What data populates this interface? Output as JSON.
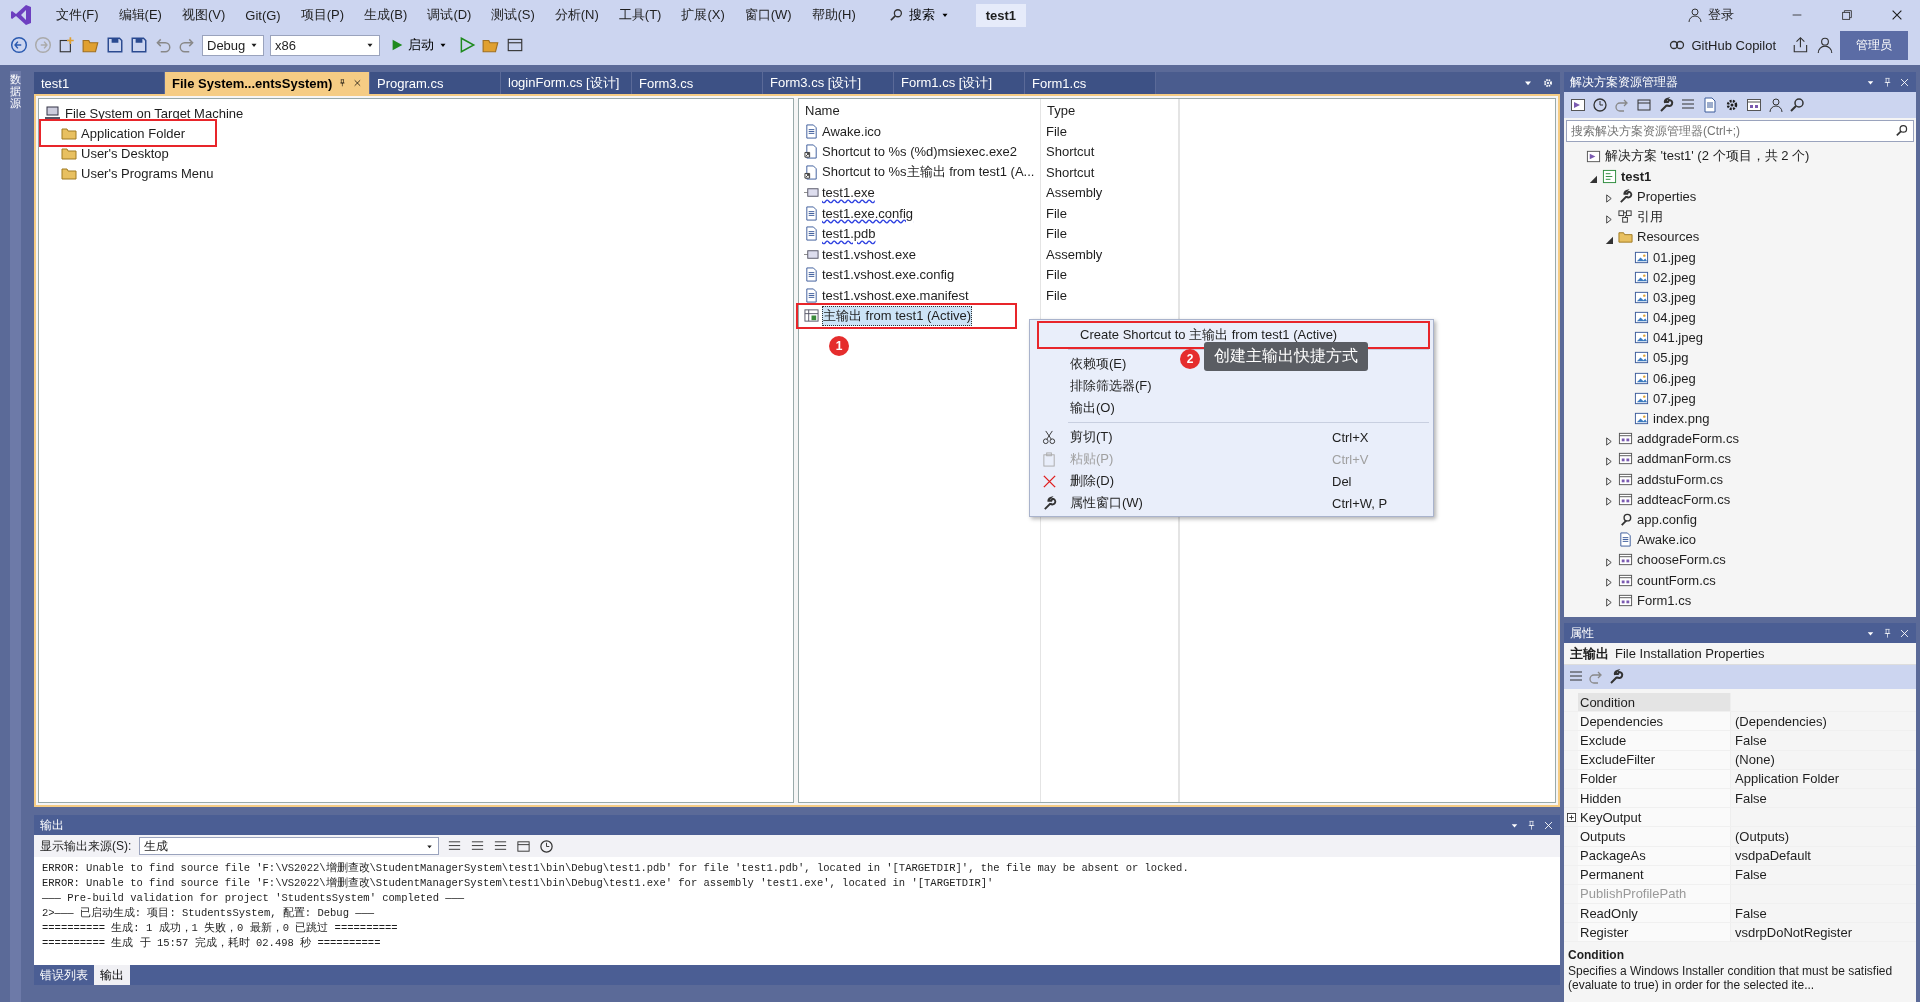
{
  "title_bar": {
    "menu": [
      "文件(F)",
      "编辑(E)",
      "视图(V)",
      "Git(G)",
      "项目(P)",
      "生成(B)",
      "调试(D)",
      "测试(S)",
      "分析(N)",
      "工具(T)",
      "扩展(X)",
      "窗口(W)",
      "帮助(H)"
    ],
    "search": "搜索",
    "solution_name": "test1",
    "login": "登录",
    "copilot": "GitHub Copilot",
    "admin_badge": "管理员"
  },
  "toolbar": {
    "configuration": "Debug",
    "platform": "x86",
    "start": "启动"
  },
  "side_strip": {
    "label": "数据源"
  },
  "doc_tabs": [
    {
      "label": "test1",
      "selected": false
    },
    {
      "label": "File System...entsSystem)",
      "selected": true
    },
    {
      "label": "Program.cs",
      "selected": false
    },
    {
      "label": "loginForm.cs [设计]",
      "selected": false
    },
    {
      "label": "Form3.cs",
      "selected": false
    },
    {
      "label": "Form3.cs [设计]",
      "selected": false
    },
    {
      "label": "Form1.cs [设计]",
      "selected": false
    },
    {
      "label": "Form1.cs",
      "selected": false
    }
  ],
  "file_system": {
    "root": "File System on Target Machine",
    "folders": [
      {
        "label": "Application Folder",
        "annotated": true
      },
      {
        "label": "User's Desktop",
        "annotated": false
      },
      {
        "label": "User's Programs Menu",
        "annotated": false
      }
    ]
  },
  "file_list": {
    "columns": [
      "Name",
      "Type"
    ],
    "rows": [
      {
        "name": "Awake.ico",
        "type": "File",
        "kind": "document",
        "warning": false,
        "selected": false
      },
      {
        "name": "Shortcut to %s (%d)msiexec.exe2",
        "type": "Shortcut",
        "kind": "shortcut",
        "warning": false,
        "selected": false
      },
      {
        "name": "Shortcut to %s主输出 from test1 (A...",
        "type": "Shortcut",
        "kind": "shortcut",
        "warning": false,
        "selected": false
      },
      {
        "name": "test1.exe",
        "type": "Assembly",
        "kind": "assembly",
        "warning": true,
        "selected": false
      },
      {
        "name": "test1.exe.config",
        "type": "File",
        "kind": "document",
        "warning": true,
        "selected": false
      },
      {
        "name": "test1.pdb",
        "type": "File",
        "kind": "document",
        "warning": true,
        "selected": false
      },
      {
        "name": "test1.vshost.exe",
        "type": "Assembly",
        "kind": "assembly",
        "warning": false,
        "selected": false
      },
      {
        "name": "test1.vshost.exe.config",
        "type": "File",
        "kind": "document",
        "warning": false,
        "selected": false
      },
      {
        "name": "test1.vshost.exe.manifest",
        "type": "File",
        "kind": "document",
        "warning": false,
        "selected": false
      },
      {
        "name": "主输出 from test1 (Active)",
        "kind": "output",
        "warning": false,
        "selected": true,
        "annotated": true,
        "marker": "1"
      }
    ]
  },
  "context_menu": [
    {
      "kind": "command",
      "label": "Create Shortcut to 主输出 from test1 (Active)",
      "disabled": false,
      "annotated": true,
      "marker": "2",
      "callout": "创建主输出快捷方式"
    },
    {
      "kind": "separator"
    },
    {
      "kind": "command",
      "label": "依赖项(E)",
      "disabled": false
    },
    {
      "kind": "command",
      "label": "排除筛选器(F)",
      "disabled": false
    },
    {
      "kind": "command",
      "label": "输出(O)",
      "disabled": false
    },
    {
      "kind": "separator"
    },
    {
      "kind": "cut",
      "label": "剪切(T)",
      "shortcut": "Ctrl+X",
      "disabled": false
    },
    {
      "kind": "paste",
      "label": "粘贴(P)",
      "shortcut": "Ctrl+V",
      "disabled": true
    },
    {
      "kind": "delete",
      "label": "删除(D)",
      "shortcut": "Del",
      "disabled": false
    },
    {
      "kind": "properties",
      "label": "属性窗口(W)",
      "shortcut": "Ctrl+W, P",
      "disabled": false
    }
  ],
  "output": {
    "title": "输出",
    "source_label": "显示输出来源(S):",
    "source": "生成",
    "lines": [
      "ERROR: Unable to find source file 'F:\\VS2022\\增删查改\\StudentManagerSystem\\test1\\bin\\Debug\\test1.pdb' for file 'test1.pdb', located in '[TARGETDIR]', the file may be absent or locked.",
      "ERROR: Unable to find source file 'F:\\VS2022\\增删查改\\StudentManagerSystem\\test1\\bin\\Debug\\test1.exe' for assembly 'test1.exe', located in '[TARGETDIR]'",
      "——— Pre-build validation for project 'StudentsSystem' completed ———",
      "2>——— 已启动生成: 项目: StudentsSystem, 配置: Debug ———",
      "========== 生成: 1 成功，1 失败，0 最新，0 已跳过 ==========",
      "========== 生成 于 15:57 完成，耗时 02.498 秒 =========="
    ],
    "tabs": [
      {
        "label": "错误列表",
        "selected": false
      },
      {
        "label": "输出",
        "selected": true
      }
    ]
  },
  "solution_explorer": {
    "title": "解决方案资源管理器",
    "search_placeholder": "搜索解决方案资源管理器(Ctrl+;)",
    "tree": [
      {
        "label": "解决方案 'test1' (2 个项目，共 2 个)",
        "kind": "solution",
        "children": [
          {
            "label": "test1",
            "kind": "project",
            "bold": true,
            "expanded": true,
            "children": [
              {
                "label": "Properties",
                "kind": "wrench",
                "expanded": false
              },
              {
                "label": "引用",
                "kind": "refs",
                "expanded": false
              },
              {
                "label": "Resources",
                "kind": "folder",
                "expanded": true,
                "children": [
                  {
                    "label": "01.jpeg",
                    "kind": "image"
                  },
                  {
                    "label": "02.jpeg",
                    "kind": "image"
                  },
                  {
                    "label": "03.jpeg",
                    "kind": "image"
                  },
                  {
                    "label": "04.jpeg",
                    "kind": "image"
                  },
                  {
                    "label": "041.jpeg",
                    "kind": "image"
                  },
                  {
                    "label": "05.jpg",
                    "kind": "image"
                  },
                  {
                    "label": "06.jpeg",
                    "kind": "image"
                  },
                  {
                    "label": "07.jpeg",
                    "kind": "image"
                  },
                  {
                    "label": "index.png",
                    "kind": "image"
                  }
                ]
              },
              {
                "label": "addgradeForm.cs",
                "kind": "form",
                "expanded": false
              },
              {
                "label": "addmanForm.cs",
                "kind": "form",
                "expanded": false
              },
              {
                "label": "addstuForm.cs",
                "kind": "form",
                "expanded": false
              },
              {
                "label": "addteacForm.cs",
                "kind": "form",
                "expanded": false
              },
              {
                "label": "app.config",
                "kind": "config"
              },
              {
                "label": "Awake.ico",
                "kind": "document"
              },
              {
                "label": "chooseForm.cs",
                "kind": "form",
                "expanded": false
              },
              {
                "label": "countForm.cs",
                "kind": "form",
                "expanded": false
              },
              {
                "label": "Form1.cs",
                "kind": "form",
                "expanded": false
              }
            ]
          }
        ]
      }
    ]
  },
  "properties": {
    "title": "属性",
    "object_name": "主输出",
    "object_type": "File Installation Properties",
    "rows": [
      {
        "name": "Condition",
        "selected": true,
        "disabled": false
      },
      {
        "name": "Dependencies",
        "value": "(Dependencies)",
        "selected": false,
        "disabled": false
      },
      {
        "name": "Exclude",
        "value": "False",
        "selected": false,
        "disabled": false
      },
      {
        "name": "ExcludeFilter",
        "value": "(None)",
        "selected": false,
        "disabled": false
      },
      {
        "name": "Folder",
        "value": "Application Folder",
        "selected": false,
        "disabled": false
      },
      {
        "name": "Hidden",
        "value": "False",
        "selected": false,
        "disabled": false
      },
      {
        "name": "KeyOutput",
        "selected": false,
        "disabled": false,
        "expanded": false
      },
      {
        "name": "Outputs",
        "value": "(Outputs)",
        "selected": false,
        "disabled": false
      },
      {
        "name": "PackageAs",
        "value": "vsdpaDefault",
        "selected": false,
        "disabled": false
      },
      {
        "name": "Permanent",
        "value": "False",
        "selected": false,
        "disabled": false
      },
      {
        "name": "PublishProfilePath",
        "selected": false,
        "disabled": true
      },
      {
        "name": "ReadOnly",
        "value": "False",
        "selected": false,
        "disabled": false
      },
      {
        "name": "Register",
        "value": "vsdrpDoNotRegister",
        "selected": false,
        "disabled": false
      }
    ],
    "description_title": "Condition",
    "description": "Specifies a Windows Installer condition that must be satisfied (evaluate to true) in order for the selected ite..."
  }
}
